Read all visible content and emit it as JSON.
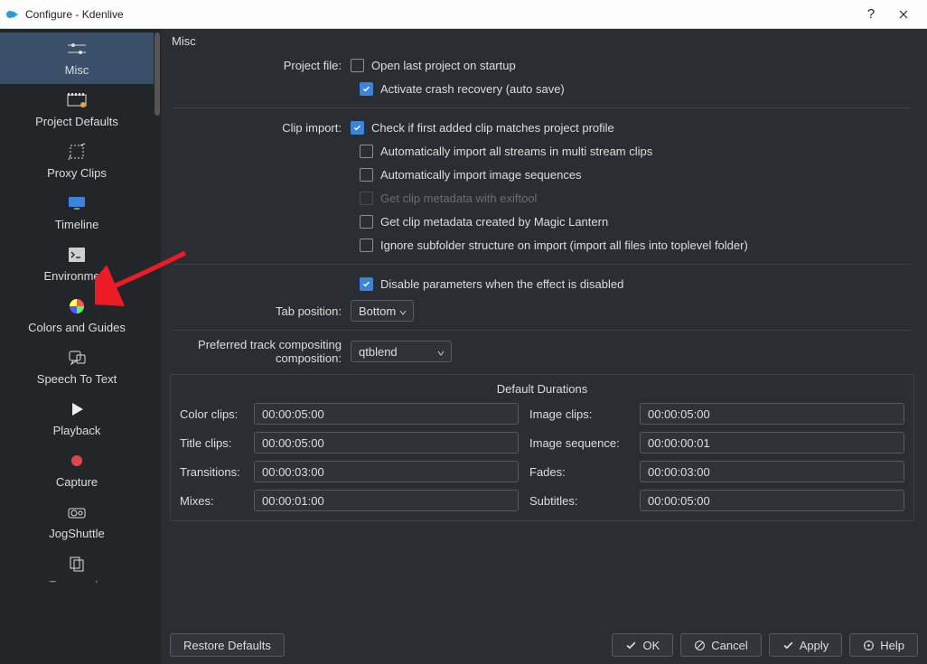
{
  "window": {
    "title": "Configure - Kdenlive"
  },
  "sidebar": {
    "items": [
      {
        "label": "Misc",
        "icon": "sliders-icon"
      },
      {
        "label": "Project Defaults",
        "icon": "film-icon"
      },
      {
        "label": "Proxy Clips",
        "icon": "crop-icon"
      },
      {
        "label": "Timeline",
        "icon": "monitor-icon"
      },
      {
        "label": "Environment",
        "icon": "terminal-icon"
      },
      {
        "label": "Colors and Guides",
        "icon": "color-wheel-icon"
      },
      {
        "label": "Speech To Text",
        "icon": "speech-icon"
      },
      {
        "label": "Playback",
        "icon": "play-icon"
      },
      {
        "label": "Capture",
        "icon": "record-icon"
      },
      {
        "label": "JogShuttle",
        "icon": "jog-icon"
      },
      {
        "label": "Transcode",
        "icon": "copy-icon"
      }
    ]
  },
  "panel": {
    "title": "Misc",
    "labels": {
      "project_file": "Project file:",
      "clip_import": "Clip import:",
      "tab_position": "Tab position:",
      "preferred_compositing": "Preferred track compositing composition:"
    },
    "checks": {
      "open_last": "Open last project on startup",
      "crash_recovery": "Activate crash recovery (auto save)",
      "check_profile": "Check if first added clip matches project profile",
      "auto_streams": "Automatically import all streams in multi stream clips",
      "auto_image_seq": "Automatically import image sequences",
      "exiftool": "Get clip metadata with exiftool",
      "magic_lantern": "Get clip metadata created by Magic Lantern",
      "ignore_subfolder": "Ignore subfolder structure on import (import all files into toplevel folder)",
      "disable_params": "Disable parameters when the effect is disabled"
    },
    "tab_position_value": "Bottom",
    "compositing_value": "qtblend",
    "durations": {
      "title": "Default Durations",
      "labels": {
        "color_clips": "Color clips:",
        "image_clips": "Image clips:",
        "title_clips": "Title clips:",
        "image_sequence": "Image sequence:",
        "transitions": "Transitions:",
        "fades": "Fades:",
        "mixes": "Mixes:",
        "subtitles": "Subtitles:"
      },
      "values": {
        "color_clips": "00:00:05:00",
        "image_clips": "00:00:05:00",
        "title_clips": "00:00:05:00",
        "image_sequence": "00:00:00:01",
        "transitions": "00:00:03:00",
        "fades": "00:00:03:00",
        "mixes": "00:00:01:00",
        "subtitles": "00:00:05:00"
      }
    }
  },
  "buttons": {
    "restore": "Restore Defaults",
    "ok": "OK",
    "cancel": "Cancel",
    "apply": "Apply",
    "help": "Help"
  }
}
